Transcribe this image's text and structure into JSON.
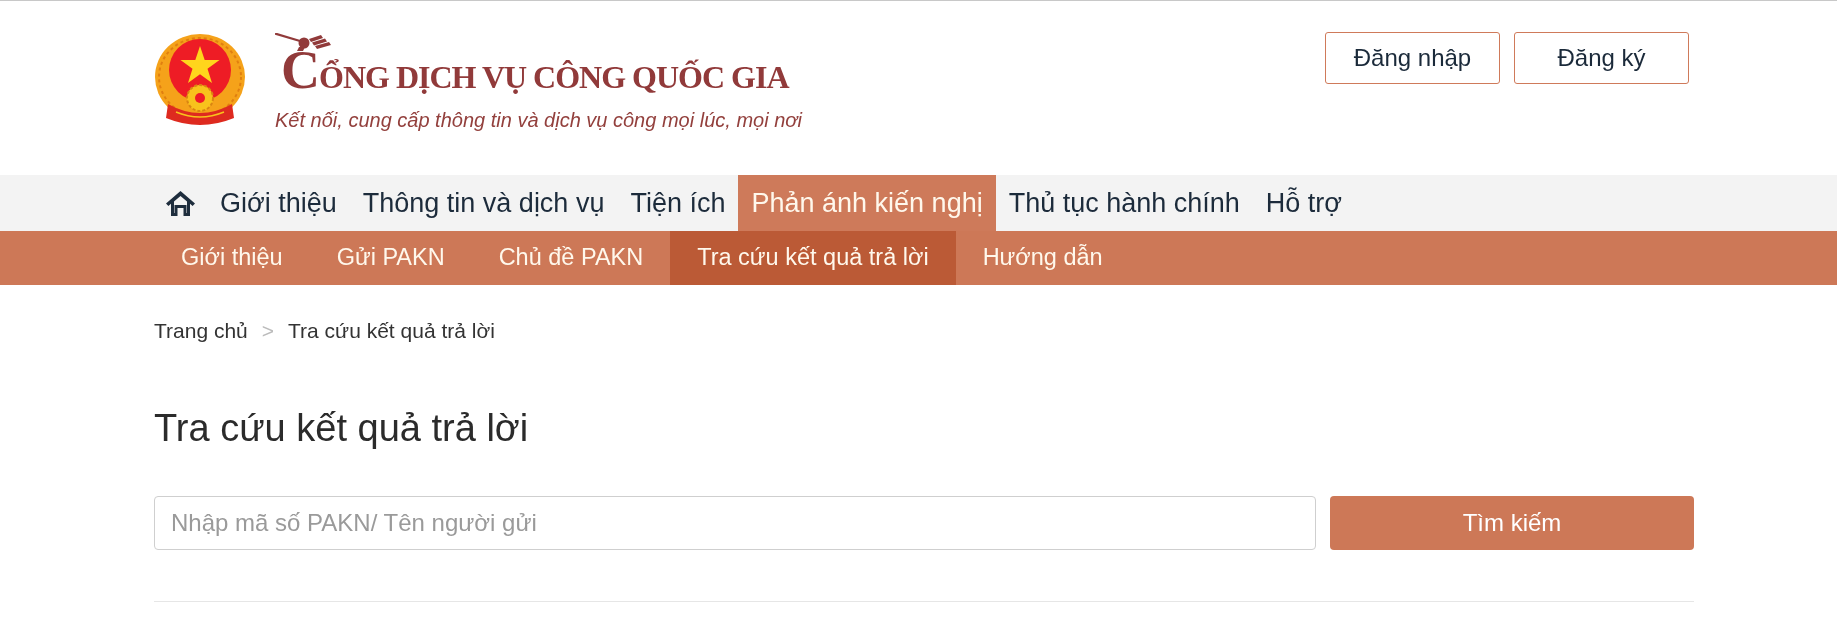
{
  "header": {
    "title": "CỔNG DỊCH VỤ CÔNG QUỐC GIA",
    "tagline": "Kết nối, cung cấp thông tin và dịch vụ công mọi lúc, mọi nơi",
    "buttons": [
      "Đăng nhập",
      "Đăng ký"
    ]
  },
  "main_nav": [
    {
      "label": "Giới thiệu",
      "selected": false
    },
    {
      "label": "Thông tin và dịch vụ",
      "selected": false
    },
    {
      "label": "Tiện ích",
      "selected": false
    },
    {
      "label": "Phản ánh kiến nghị",
      "selected": true
    },
    {
      "label": "Thủ tục hành chính",
      "selected": false
    },
    {
      "label": "Hỗ trợ",
      "selected": false
    }
  ],
  "sub_nav": [
    {
      "label": "Giới thiệu",
      "selected": false
    },
    {
      "label": "Gửi PAKN",
      "selected": false
    },
    {
      "label": "Chủ đề PAKN",
      "selected": false
    },
    {
      "label": "Tra cứu kết quả trả lời",
      "selected": true
    },
    {
      "label": "Hướng dẫn",
      "selected": false
    }
  ],
  "breadcrumb": {
    "items": [
      "Trang chủ",
      "Tra cứu kết quả trả lời"
    ],
    "separator": ">"
  },
  "page_title": "Tra cứu kết quả trả lời",
  "search": {
    "placeholder": "Nhập mã số PAKN/ Tên người gửi",
    "button": "Tìm kiếm"
  }
}
